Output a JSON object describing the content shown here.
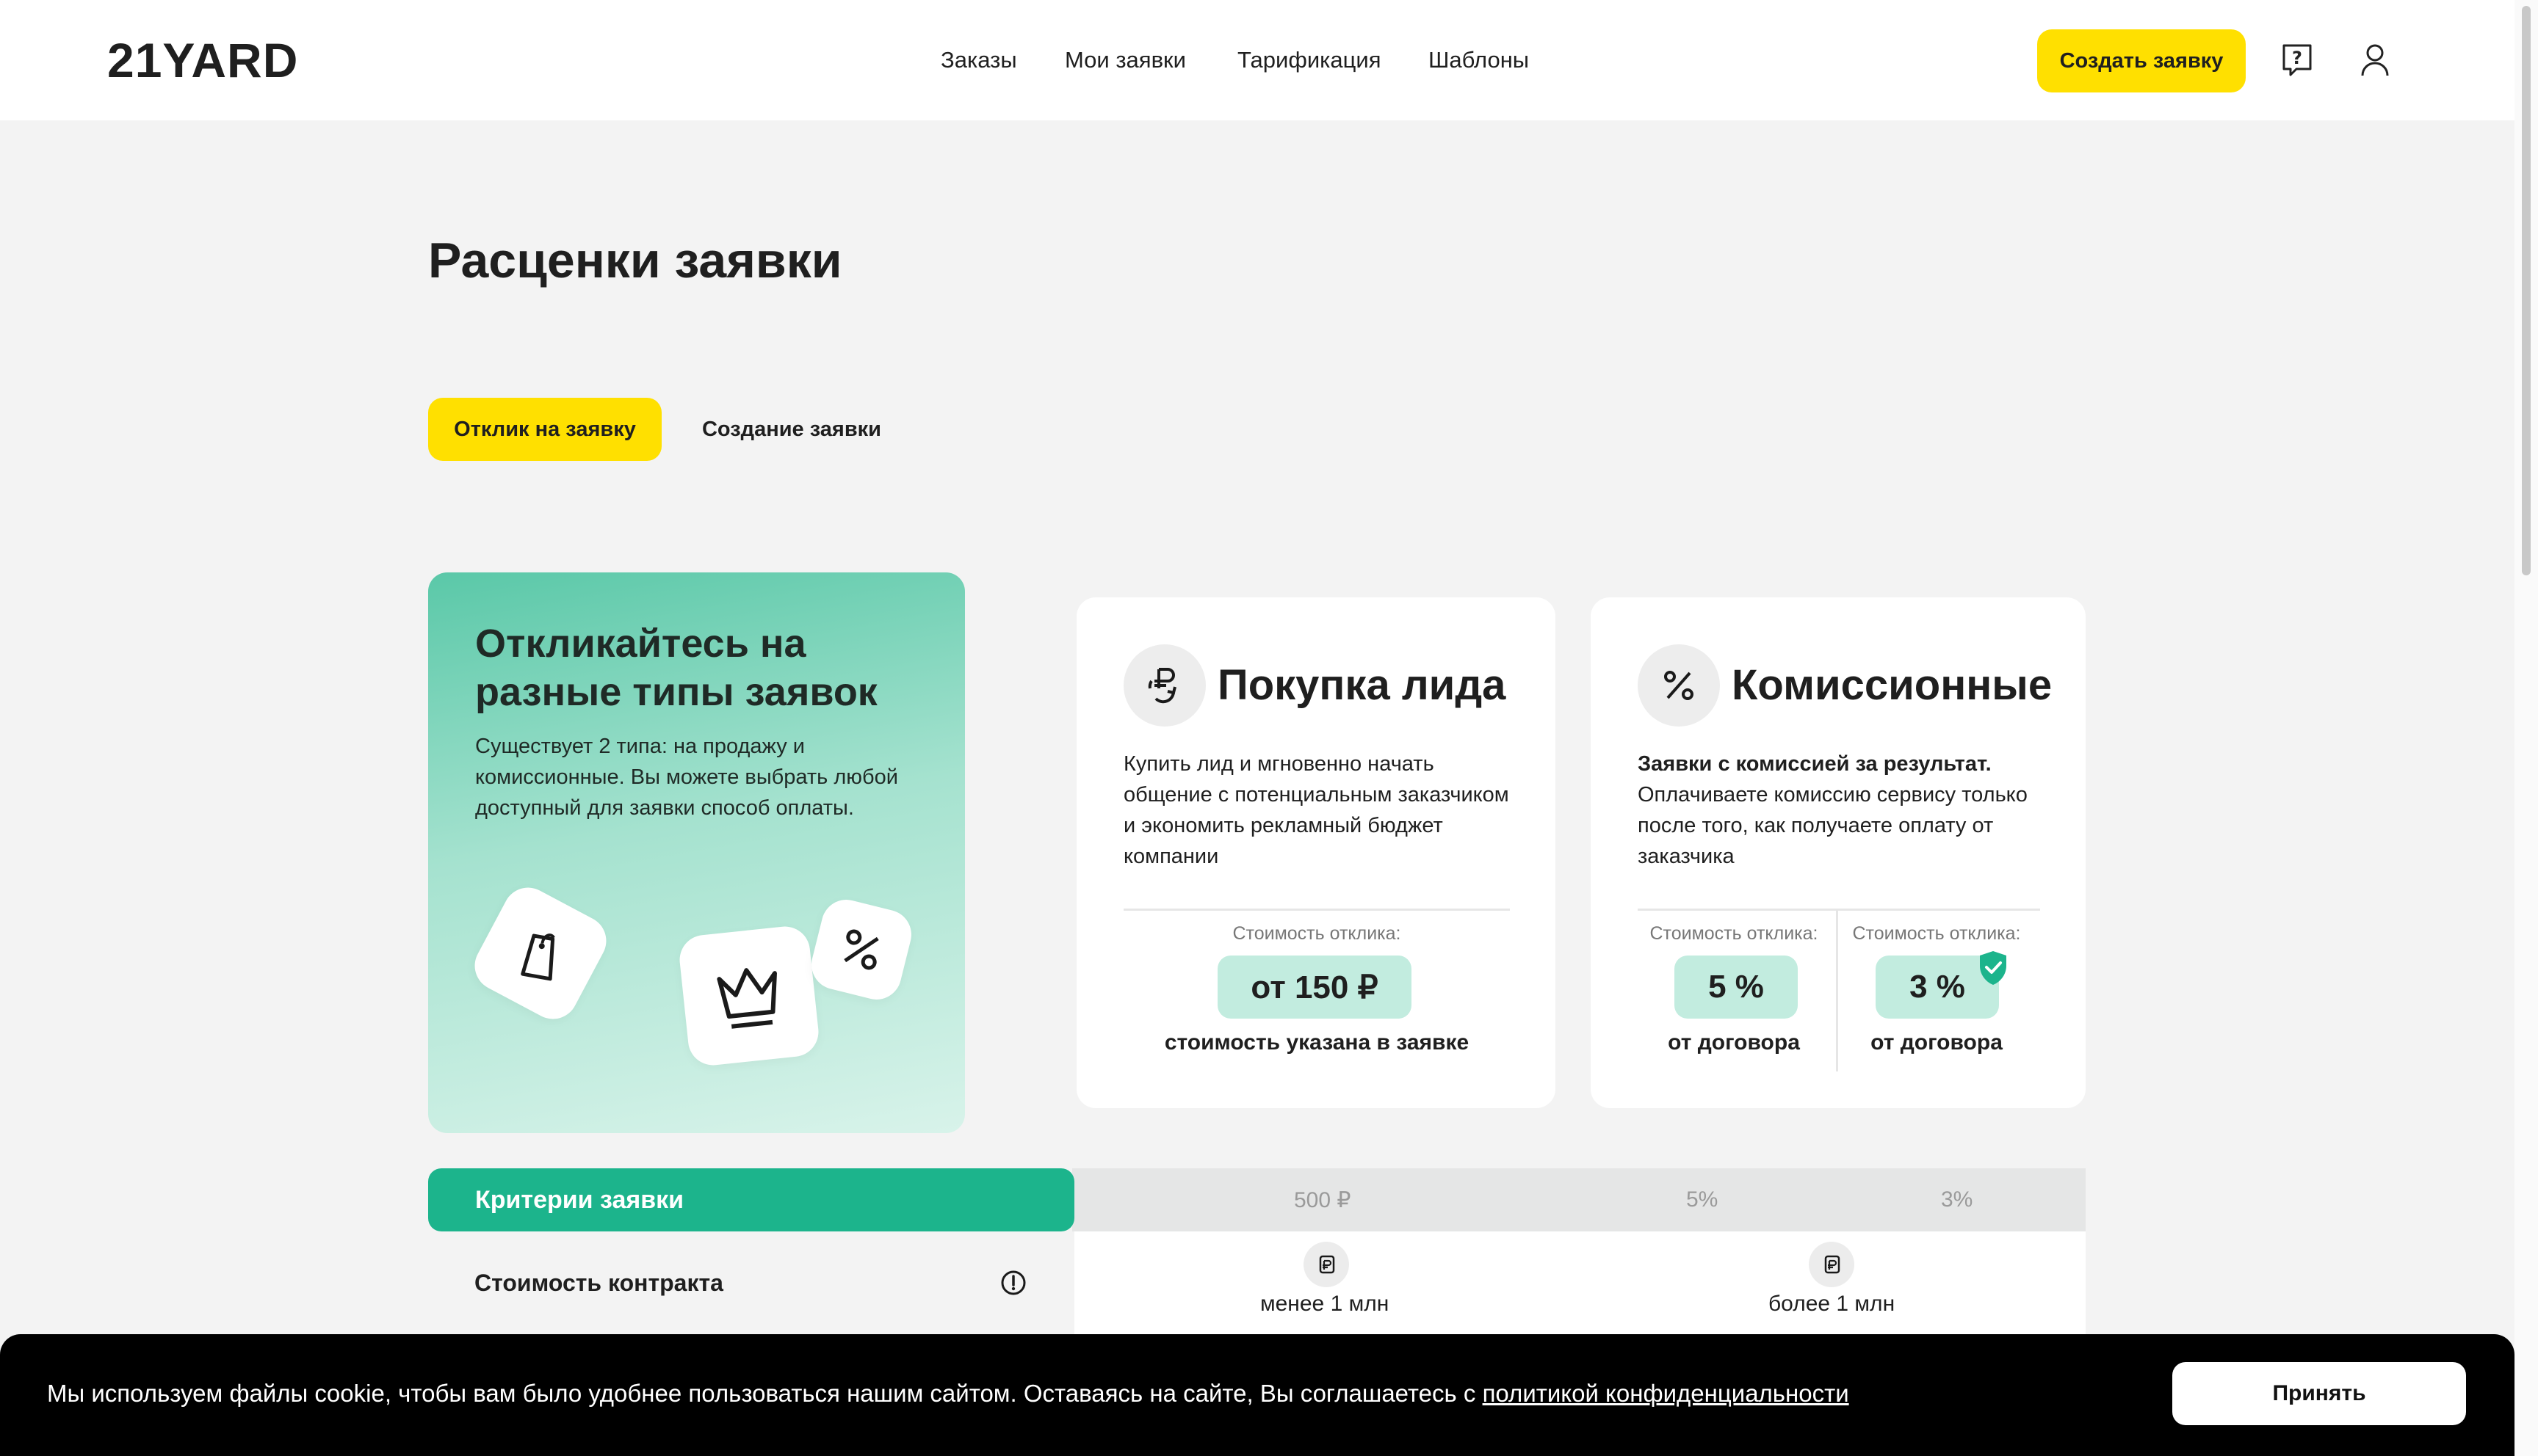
{
  "header": {
    "logo": "21YARD",
    "nav": [
      "Заказы",
      "Мои заявки",
      "Тарификация",
      "Шаблоны"
    ],
    "create_button": "Создать заявку",
    "help_icon": "help-icon",
    "profile_icon": "user-icon"
  },
  "page": {
    "title": "Расценки заявки",
    "tabs": [
      {
        "label": "Отклик на заявку",
        "active": true
      },
      {
        "label": "Создание заявки",
        "active": false
      }
    ]
  },
  "promo": {
    "title": "Откликайтесь на разные типы заявок",
    "text": "Существует 2 типа: на продажу и комиссионные. Вы можете выбрать любой доступный для заявки способ оплаты.",
    "icons": [
      "tag-icon",
      "crown-icon",
      "percent-icon"
    ]
  },
  "cards": {
    "lead": {
      "icon": "ruble-exchange-icon",
      "title": "Покупка лида",
      "text": "Купить лид и мгновенно начать общение с потенциальным заказчиком и экономить рекламный бюджет компании",
      "price_label": "Стоимость отклика:",
      "price": "от 150 ₽",
      "price_note": "стоимость указана в заявке"
    },
    "commission": {
      "icon": "percent-icon",
      "title": "Комиссионные",
      "text_bold": "Заявки с комиссией за результат.",
      "text": "Оплачиваете комиссию сервису только после того, как получаете оплату от заказчика",
      "options": [
        {
          "label": "Стоимость отклика:",
          "value": "5 %",
          "note": "от договора",
          "badge": false
        },
        {
          "label": "Стоимость отклика:",
          "value": "3 %",
          "note": "от договора",
          "badge": true
        }
      ]
    }
  },
  "criteria": {
    "title": "Критерии заявки",
    "columns": [
      "500 ₽",
      "5%",
      "3%"
    ],
    "rows": [
      {
        "label": "Стоимость контракта",
        "values": [
          "менее 1 млн",
          "более 1 млн"
        ]
      }
    ]
  },
  "cookie": {
    "text": "Мы используем файлы cookie, чтобы вам было удобнее пользоваться нашим сайтом. Оставаясь на сайте, Вы соглашаетесь с ",
    "link": "политикой конфиденциальности",
    "accept": "Принять"
  },
  "colors": {
    "accent_yellow": "#ffe000",
    "accent_green": "#1cb48c",
    "pill_green": "#c2ecdf",
    "background": "#f3f3f3"
  }
}
